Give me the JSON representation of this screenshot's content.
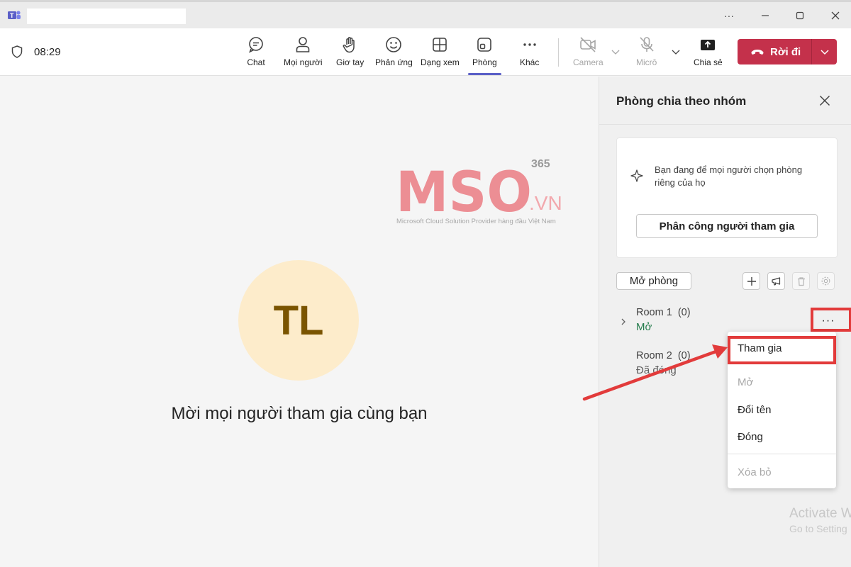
{
  "window": {
    "minimize_icon": "minimize-icon",
    "maximize_icon": "maximize-icon",
    "close_icon": "close-icon",
    "more_glyph": "···"
  },
  "toolbar": {
    "timer": "08:29",
    "items": [
      {
        "label": "Chat",
        "icon": "chat-icon"
      },
      {
        "label": "Mọi người",
        "icon": "people-icon"
      },
      {
        "label": "Giơ tay",
        "icon": "raise-hand-icon"
      },
      {
        "label": "Phản ứng",
        "icon": "reaction-icon"
      },
      {
        "label": "Dạng xem",
        "icon": "view-icon"
      },
      {
        "label": "Phòng",
        "icon": "rooms-icon",
        "active": true
      },
      {
        "label": "Khác",
        "icon": "more-icon"
      },
      {
        "label": "Camera",
        "icon": "camera-off-icon",
        "disabled": true
      },
      {
        "label": "Micrô",
        "icon": "mic-off-icon",
        "disabled": true
      },
      {
        "label": "Chia sẻ",
        "icon": "share-icon"
      }
    ],
    "leave_label": "Rời đi"
  },
  "stage": {
    "watermark": {
      "brand": "MSO",
      "suffix": ".VN",
      "badge": "365",
      "tagline": "Microsoft Cloud Solution Provider hàng đầu Việt Nam"
    },
    "avatar_initials": "TL",
    "invite_text": "Mời mọi người tham gia cùng bạn"
  },
  "panel": {
    "title": "Phòng chia theo nhóm",
    "card_message": "Bạn đang để mọi người chọn phòng riêng của họ",
    "assign_button": "Phân công người tham gia",
    "open_rooms_button": "Mở phòng",
    "rooms": [
      {
        "name": "Room 1",
        "count": "(0)",
        "status": "Mở"
      },
      {
        "name": "Room 2",
        "count": "(0)",
        "status": "Đã đóng"
      }
    ],
    "more_glyph": "···"
  },
  "context_menu": {
    "items": [
      "Tham gia",
      "Mở",
      "Đổi tên",
      "Đóng",
      "Xóa bỏ"
    ]
  },
  "os_watermark": {
    "line1": "Activate W",
    "line2": "Go to Setting"
  },
  "colors": {
    "accent": "#5b5fc7",
    "leave": "#c4314b",
    "open_status": "#237b4b",
    "highlight": "#e23b3b",
    "avatar_bg": "#fdeccb"
  }
}
